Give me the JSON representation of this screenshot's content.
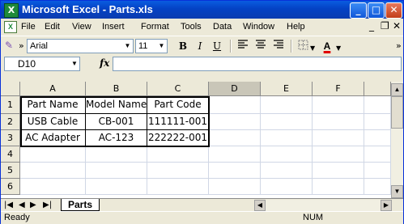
{
  "window": {
    "title": "Microsoft Excel - Parts.xls",
    "app_icon": "X",
    "minimize": "_",
    "maximize": "□",
    "close": "✕"
  },
  "menubar": {
    "items": [
      "File",
      "Edit",
      "View",
      "Insert",
      "Format",
      "Tools",
      "Data",
      "Window",
      "Help"
    ],
    "doc_minimize": "_",
    "doc_restore": "❐",
    "doc_close": "✕"
  },
  "toolbar": {
    "overflow": "»",
    "font_name": "Arial",
    "font_size": "11",
    "bold": "B",
    "italic": "I",
    "underline": "U",
    "font_color_label": "A",
    "end_overflow": "»"
  },
  "formula_bar": {
    "name_box": "D10",
    "fx_label": "fx",
    "formula": ""
  },
  "columns": [
    "A",
    "B",
    "C",
    "D",
    "E",
    "F"
  ],
  "rows": [
    "1",
    "2",
    "3",
    "4",
    "5",
    "6"
  ],
  "cells": [
    [
      "Part Name",
      "Model Name",
      "Part Code",
      "",
      "",
      ""
    ],
    [
      "USB Cable",
      "CB-001",
      "111111-001",
      "",
      "",
      ""
    ],
    [
      "AC Adapter",
      "AC-123",
      "222222-001",
      "",
      "",
      ""
    ],
    [
      "",
      "",
      "",
      "",
      "",
      ""
    ],
    [
      "",
      "",
      "",
      "",
      "",
      ""
    ],
    [
      "",
      "",
      "",
      "",
      "",
      ""
    ]
  ],
  "sheets": {
    "active": "Parts"
  },
  "status": {
    "text": "Ready",
    "num": "NUM"
  }
}
